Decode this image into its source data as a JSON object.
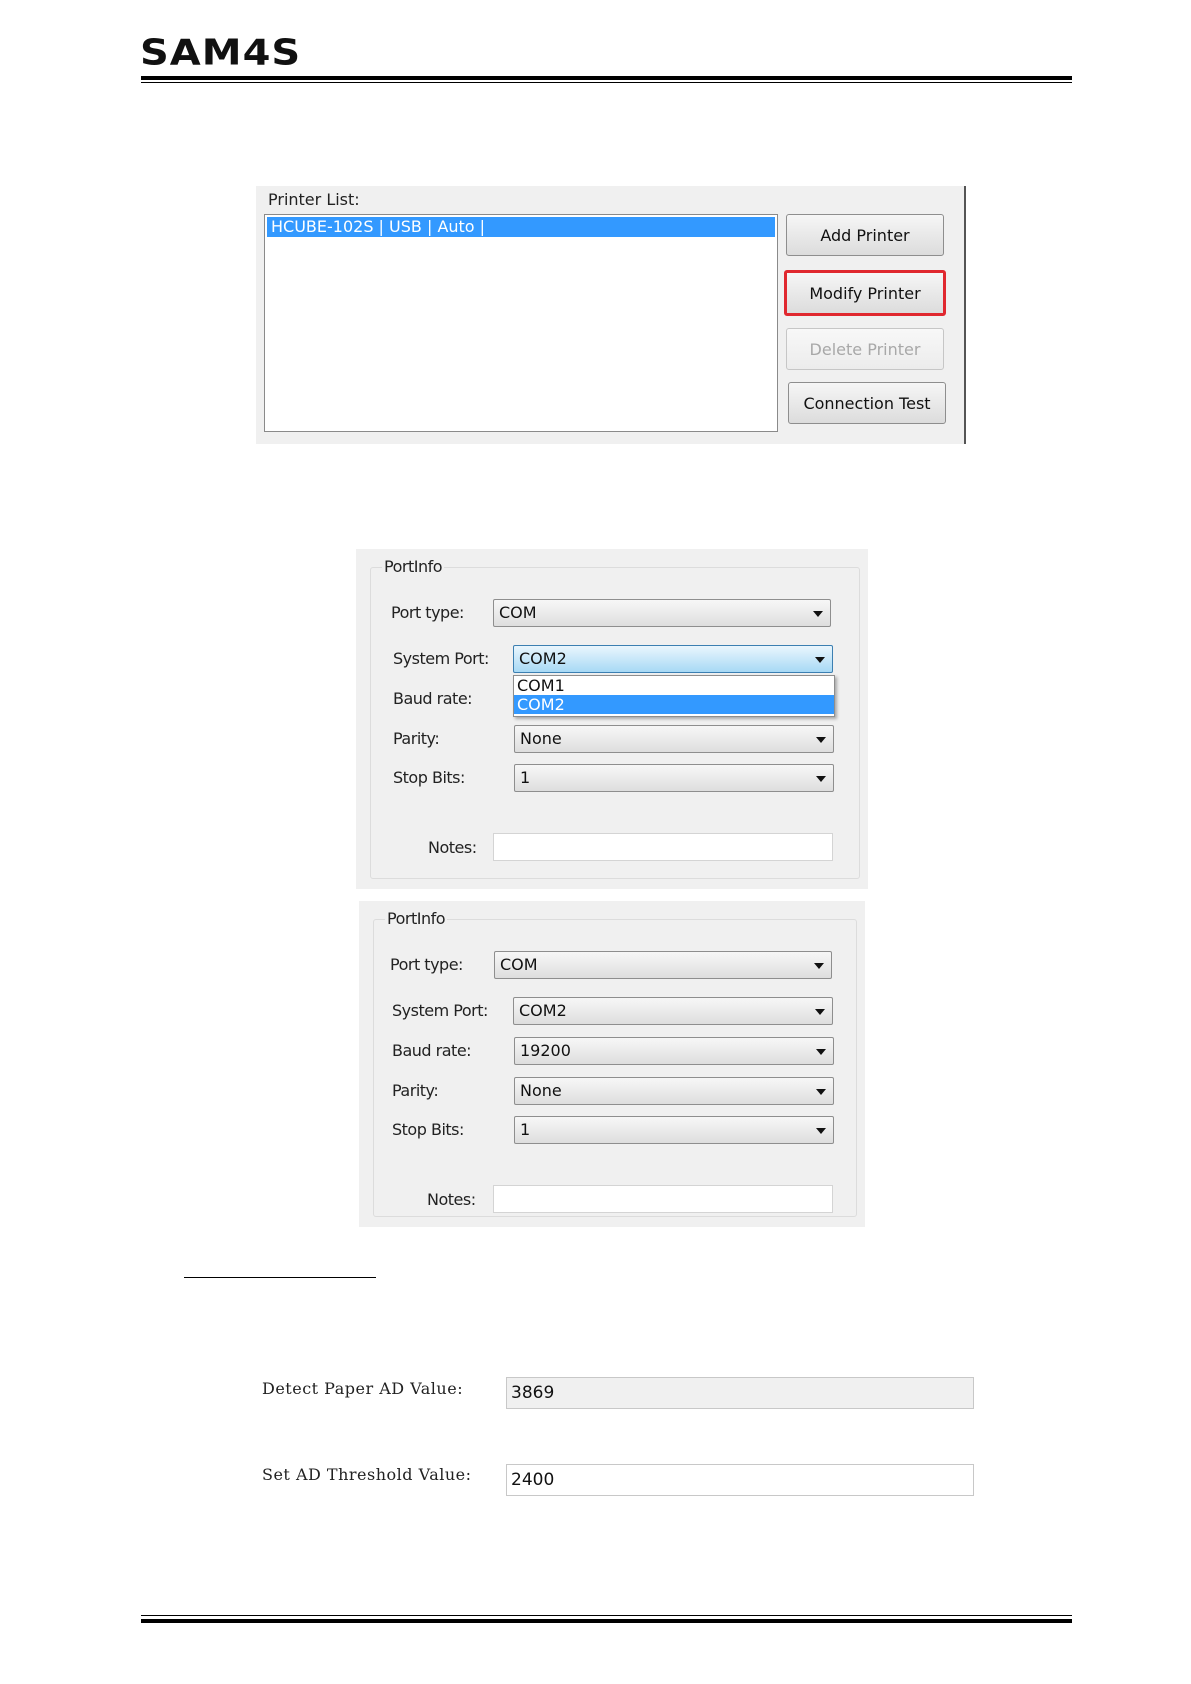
{
  "header": {
    "logo": "SAM4S"
  },
  "printer_list": {
    "label": "Printer List:",
    "items": [
      "HCUBE-102S | USB | Auto |"
    ],
    "buttons": {
      "add": "Add Printer",
      "modify": "Modify Printer",
      "delete": "Delete Printer",
      "test": "Connection Test"
    }
  },
  "port_info_1": {
    "title": "PortInfo",
    "labels": {
      "port_type": "Port type:",
      "system_port": "System Port:",
      "baud_rate": "Baud rate:",
      "parity": "Parity:",
      "stop_bits": "Stop Bits:",
      "notes": "Notes:"
    },
    "port_type": "COM",
    "system_port": "COM2",
    "dropdown_options": [
      "COM1",
      "COM2"
    ],
    "dropdown_selected": "COM2",
    "parity": "None",
    "stop_bits": "1"
  },
  "port_info_2": {
    "title": "PortInfo",
    "labels": {
      "port_type": "Port type:",
      "system_port": "System Port:",
      "baud_rate": "Baud rate:",
      "parity": "Parity:",
      "stop_bits": "Stop Bits:",
      "notes": "Notes:"
    },
    "port_type": "COM",
    "system_port": "COM2",
    "baud_rate": "19200",
    "parity": "None",
    "stop_bits": "1"
  },
  "ad_settings": {
    "detect_label": "Detect Paper AD Value:",
    "detect_value": "3869",
    "threshold_label": "Set AD Threshold Value:",
    "threshold_value": "2400"
  }
}
